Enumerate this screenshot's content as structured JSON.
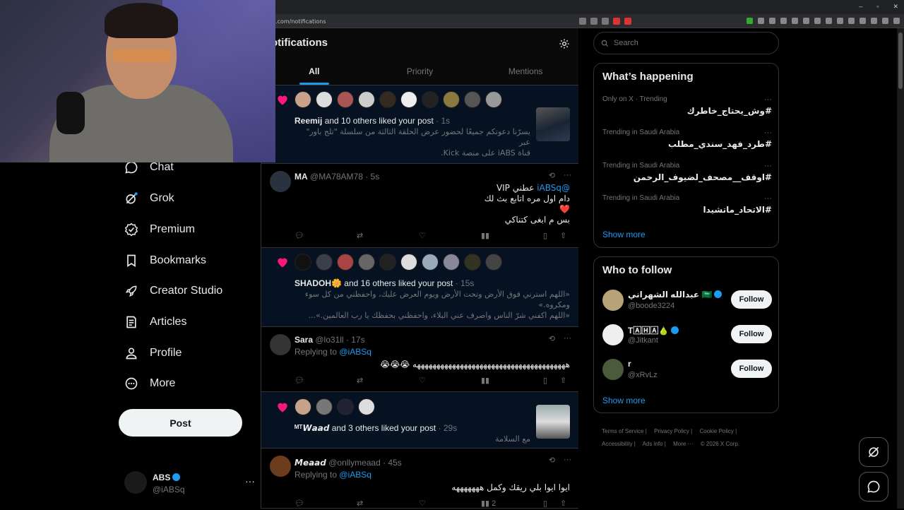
{
  "browser": {
    "url": ".com/notifications"
  },
  "sidebar": {
    "items": [
      {
        "label": "Chat",
        "icon": "chat-icon"
      },
      {
        "label": "Grok",
        "icon": "grok-icon"
      },
      {
        "label": "Premium",
        "icon": "premium-icon"
      },
      {
        "label": "Bookmarks",
        "icon": "bookmark-icon"
      },
      {
        "label": "Creator Studio",
        "icon": "rocket-icon"
      },
      {
        "label": "Articles",
        "icon": "articles-icon"
      },
      {
        "label": "Profile",
        "icon": "profile-icon"
      },
      {
        "label": "More",
        "icon": "more-circle-icon"
      }
    ],
    "post_label": "Post",
    "account": {
      "name": "ABS",
      "handle": "@iABSq",
      "more": "···"
    }
  },
  "main": {
    "title": "otifications",
    "tabs": [
      {
        "label": "All"
      },
      {
        "label": "Priority"
      },
      {
        "label": "Mentions"
      }
    ],
    "items": [
      {
        "who": "Reemij",
        "rest": " and 10 others liked your post",
        "time": " · 1s",
        "snippet1": "يسرّنا دعوتكم جميعًا لحضور عرض الحلقة الثالثة من سلسلة \"تلج باور\" عبر",
        "snippet2": "قناة iABS على منصة Kick.",
        "snippet3": "..."
      },
      {
        "name": "MA",
        "handle": "@MA78AM78 · 5s",
        "line1_at": "@iABSq",
        "line1_rest": " عطني VIP",
        "line2": "دام اول مره اتابع بث لك",
        "line3": "❤️",
        "line4": "بس م ابغى كتناكي"
      },
      {
        "who": "SHADOH🌼",
        "rest": " and 16 others liked your post",
        "time": " · 15s",
        "snippet1": "«اللهم استرني فوق الأرض وتحت الأرض ويوم العرض عليك، واحفظني من كل سوء",
        "snippet2": "ومكروه.»",
        "snippet3": "«اللهم اكفني شرّ الناس واصرف عني البلاء، واحفظني بحفظك يا رب العالمين.»..."
      },
      {
        "name": "Sara",
        "handle": "@lo31ll · 17s",
        "replying": "Replying to ",
        "reply_at": "@iABSq",
        "text": "هههههههههههههههههههههههههههههههههههههههه 😭😭😭"
      },
      {
        "who": "ᴹᵀ𝙒𝙖𝙖𝙙",
        "rest": " and 3 others liked your post",
        "time": " · 29s",
        "snippet1": "مع السلامة"
      },
      {
        "name": "𝙈𝙚𝙖𝙖𝙙",
        "handle": "@onllymeaad · 45s",
        "replying": "Replying to ",
        "reply_at": "@iABSq",
        "text": "ايوا ايوا بلي ريقك وكمل هههههههه",
        "views": "2"
      }
    ]
  },
  "search": {
    "placeholder": "Search"
  },
  "happening": {
    "title": "What’s happening",
    "trends": [
      {
        "meta": "Only on X · Trending",
        "tag": "#وش_يحتاج_خاطرك"
      },
      {
        "meta": "Trending in Saudi Arabia",
        "tag": "#طرد_فهد_سندي_مطلب"
      },
      {
        "meta": "Trending in Saudi Arabia",
        "tag": "#اوقف__مصحف_لضيوف_الرحمن"
      },
      {
        "meta": "Trending in Saudi Arabia",
        "tag": "#الاتحاد_ماتشيدا"
      }
    ],
    "show_more": "Show more"
  },
  "follow": {
    "title": "Who to follow",
    "users": [
      {
        "name": "عبدالله الشهراني 🇸🇦",
        "handle": "@boode3224",
        "button": "Follow"
      },
      {
        "name": "T🄰🄷🄰🍐",
        "handle": "@Jitkant",
        "button": "Follow"
      },
      {
        "name": "r",
        "handle": "@xRvLz",
        "button": "Follow"
      }
    ],
    "show_more": "Show more"
  },
  "footer": {
    "links": [
      "Terms of Service |",
      "Privacy Policy |",
      "Cookie Policy |",
      "Accessibility |",
      "Ads info |",
      "More ···",
      "© 2026 X Corp."
    ]
  },
  "colors": {
    "accent": "#1d9bf0",
    "heart": "#f91880",
    "background": "#000000",
    "border": "#2f3336"
  }
}
